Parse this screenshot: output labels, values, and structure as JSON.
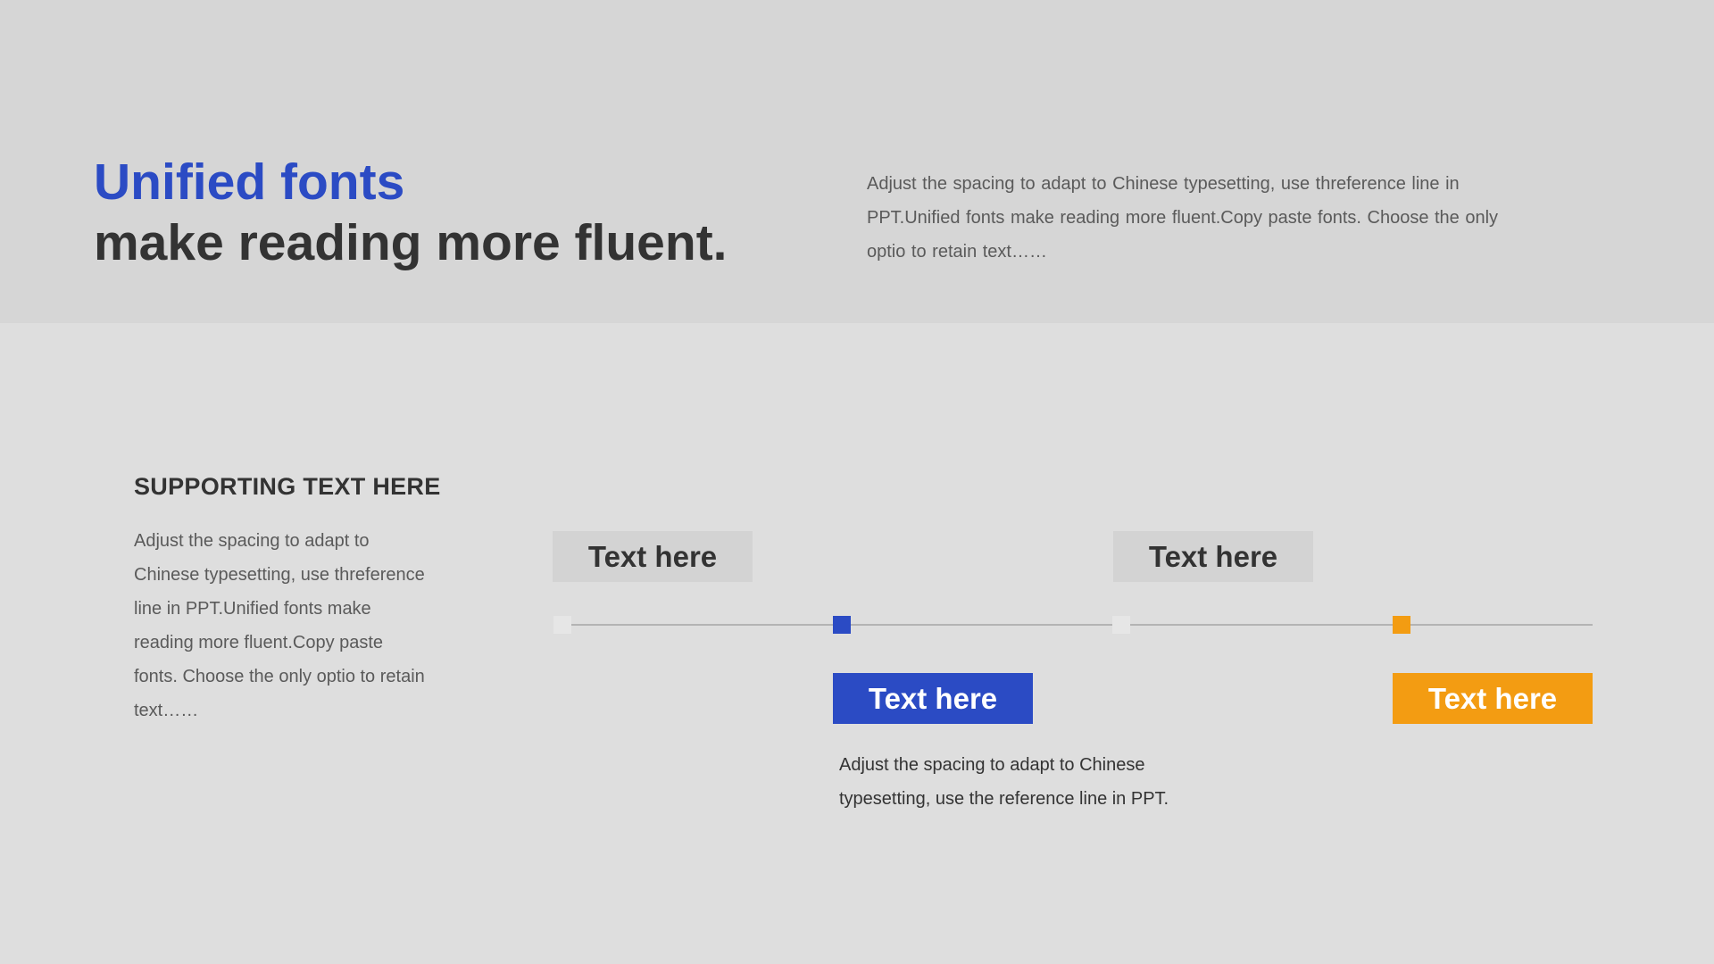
{
  "header": {
    "title_accent": "Unified fonts",
    "title_main": "make reading more fluent.",
    "description": "Adjust the spacing to adapt to Chinese typesetting, use threference line in PPT.Unified fonts make reading more fluent.Copy paste fonts. Choose the only optio to retain text……"
  },
  "support": {
    "heading": "SUPPORTING TEXT HERE",
    "body": "Adjust the spacing to adapt to Chinese typesetting, use threference line in PPT.Unified fonts make reading more fluent.Copy paste fonts. Choose the only optio to retain text……"
  },
  "timeline": {
    "labels": [
      "Text here",
      "Text here",
      "Text here",
      "Text here"
    ],
    "description": "Adjust the spacing to adapt to Chinese typesetting, use the reference line in PPT."
  },
  "colors": {
    "accent_blue": "#2b4bc4",
    "accent_orange": "#f39c12",
    "neutral_gray": "#d3d3d3",
    "text_dark": "#333333"
  }
}
